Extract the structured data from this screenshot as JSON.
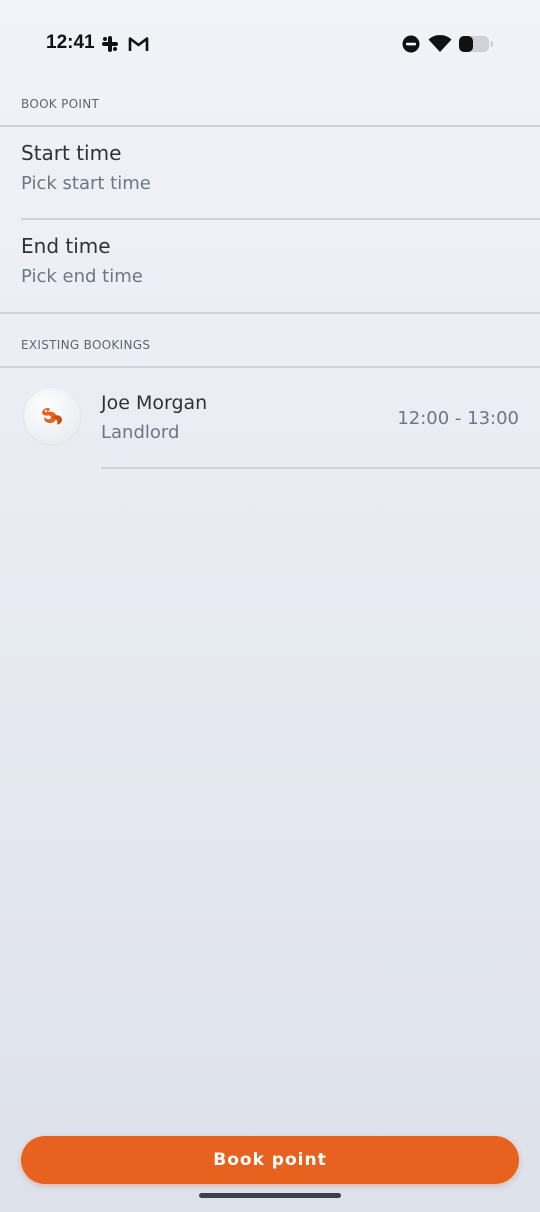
{
  "status_bar": {
    "time": "12:41",
    "left_icons": [
      "slack-icon",
      "gmail-icon"
    ],
    "right_icons": [
      "dnd-icon",
      "wifi-icon",
      "battery-icon"
    ]
  },
  "book_point_section": {
    "header": "BOOK POINT",
    "start_time": {
      "label": "Start time",
      "placeholder": "Pick start time"
    },
    "end_time": {
      "label": "End time",
      "placeholder": "Pick end time"
    }
  },
  "existing_bookings_section": {
    "header": "EXISTING BOOKINGS",
    "bookings": [
      {
        "name": "Joe Morgan",
        "role": "Landlord",
        "time_range": "12:00 - 13:00",
        "avatar_icon": "fox-logo-icon"
      }
    ]
  },
  "actions": {
    "book_button_label": "Book point"
  },
  "colors": {
    "accent": "#e8621f",
    "background_top": "#f1f3f8",
    "background_bottom": "#dde1ea",
    "secondary_text": "#6c7686"
  }
}
